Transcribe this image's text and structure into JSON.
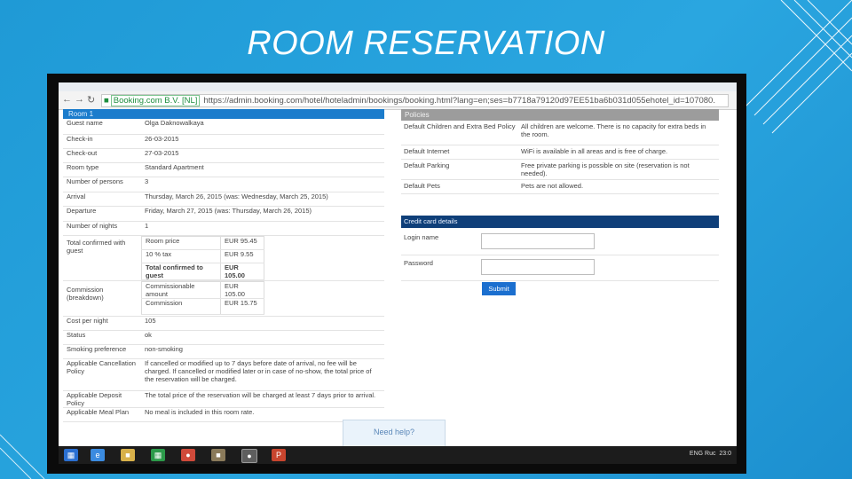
{
  "slide": {
    "title": "ROOM RESERVATION"
  },
  "browser": {
    "ev_badge": "Booking.com B.V. [NL]",
    "url": "https://admin.booking.com/hotel/hoteladmin/bookings/booking.html?lang=en;ses=b7718a79120d97EE51ba6b031d055ehotel_id=107080."
  },
  "reservation": {
    "header": "Room 1",
    "rows": [
      {
        "label": "Guest name",
        "value": "Olga Daknowalkaya"
      },
      {
        "label": "Check-in",
        "value": "26-03-2015"
      },
      {
        "label": "Check-out",
        "value": "27-03-2015"
      },
      {
        "label": "Room type",
        "value": "Standard Apartment"
      },
      {
        "label": "Number of persons",
        "value": "3"
      },
      {
        "label": "Arrival",
        "value": "Thursday, March 26, 2015 (was: Wednesday, March 25, 2015)"
      },
      {
        "label": "Departure",
        "value": "Friday, March 27, 2015 (was: Thursday, March 26, 2015)"
      },
      {
        "label": "Number of nights",
        "value": "1"
      }
    ],
    "total_label": "Total confirmed with guest",
    "total_rows": [
      {
        "label": "Room price",
        "value": "EUR 95.45"
      },
      {
        "label": "10 % tax",
        "value": "EUR 9.55"
      },
      {
        "label": "Total confirmed to guest",
        "value": "EUR 105.00"
      }
    ],
    "commission_label": "Commission (breakdown)",
    "commission_rows": [
      {
        "label": "Commissionable amount",
        "value": "EUR 105.00"
      },
      {
        "label": "Commission",
        "value": "EUR 15.75"
      }
    ],
    "rows2": [
      {
        "label": "Cost per night",
        "value": "105"
      },
      {
        "label": "Status",
        "value": "ok"
      },
      {
        "label": "Smoking preference",
        "value": "non-smoking"
      },
      {
        "label": "Applicable Cancellation Policy",
        "value": "If cancelled or modified up to 7 days before date of arrival, no fee will be charged. If cancelled or modified later or in case of no-show, the total price of the reservation will be charged."
      },
      {
        "label": "Applicable Deposit Policy",
        "value": "The total price of the reservation will be charged at least 7 days prior to arrival."
      },
      {
        "label": "Applicable Meal Plan",
        "value": "No meal is included in this room rate."
      }
    ]
  },
  "policies": {
    "header": "Policies",
    "rows": [
      {
        "label": "Default Children and Extra Bed Policy",
        "value": "All children are welcome. There is no capacity for extra beds in the room."
      },
      {
        "label": "Default Internet",
        "value": "WiFi is available in all areas and is free of charge."
      },
      {
        "label": "Default Parking",
        "value": "Free private parking is possible on site (reservation is not needed)."
      },
      {
        "label": "Default Pets",
        "value": "Pets are not allowed."
      }
    ]
  },
  "credit_card": {
    "header": "Credit card details",
    "login_label": "Login name",
    "password_label": "Password",
    "submit_label": "Submit"
  },
  "help": {
    "label": "Need help?"
  },
  "taskbar": {
    "tray_text": "ENG  Ruc",
    "clock": "23:0"
  }
}
